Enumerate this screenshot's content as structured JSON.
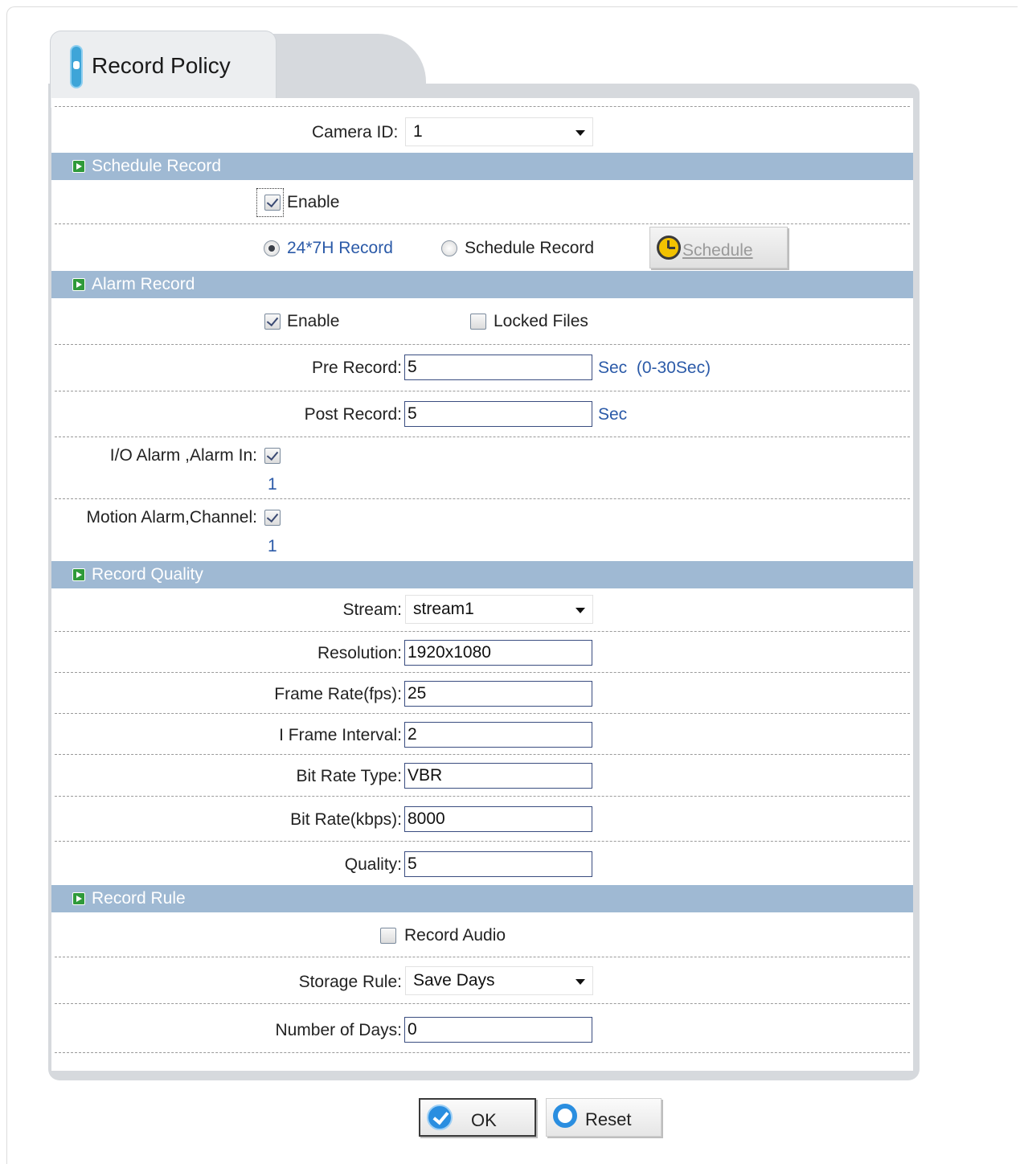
{
  "tab": {
    "title": "Record Policy"
  },
  "camera": {
    "label": "Camera ID:",
    "value": "1"
  },
  "schedule_record": {
    "header": "Schedule Record",
    "enable_label": "Enable",
    "enable_checked": true,
    "mode_24x7_label": "24*7H Record",
    "mode_schedule_label": "Schedule Record",
    "selected_mode": "24*7H Record",
    "schedule_button_label": "Schedule"
  },
  "alarm_record": {
    "header": "Alarm Record",
    "enable_label": "Enable",
    "enable_checked": true,
    "locked_files_label": "Locked Files",
    "locked_files_checked": false,
    "pre_record_label": "Pre Record:",
    "pre_record_value": "5",
    "pre_record_unit": "Sec  (0-30Sec)",
    "post_record_label": "Post Record:",
    "post_record_value": "5",
    "post_record_unit": "Sec",
    "io_alarm_label": "I/O Alarm ,Alarm In:",
    "io_alarm_channel": "1",
    "io_alarm_checked": true,
    "motion_alarm_label": "Motion Alarm,Channel:",
    "motion_alarm_channel": "1",
    "motion_alarm_checked": true
  },
  "record_quality": {
    "header": "Record Quality",
    "stream_label": "Stream:",
    "stream_value": "stream1",
    "resolution_label": "Resolution:",
    "resolution_value": "1920x1080",
    "frame_rate_label": "Frame Rate(fps):",
    "frame_rate_value": "25",
    "iframe_label": "I Frame Interval:",
    "iframe_value": "2",
    "bitrate_type_label": "Bit Rate Type:",
    "bitrate_type_value": "VBR",
    "bitrate_label": "Bit Rate(kbps):",
    "bitrate_value": "8000",
    "quality_label": "Quality:",
    "quality_value": "5"
  },
  "record_rule": {
    "header": "Record Rule",
    "record_audio_label": "Record Audio",
    "record_audio_checked": false,
    "storage_rule_label": "Storage Rule:",
    "storage_rule_value": "Save Days",
    "days_label": "Number of Days:",
    "days_value": "0"
  },
  "buttons": {
    "ok_label": "OK",
    "reset_label": "Reset"
  },
  "colors": {
    "section_header": "#9fb9d3",
    "accent_blue": "#2a8ee0",
    "link_text": "#2b5aa8"
  }
}
